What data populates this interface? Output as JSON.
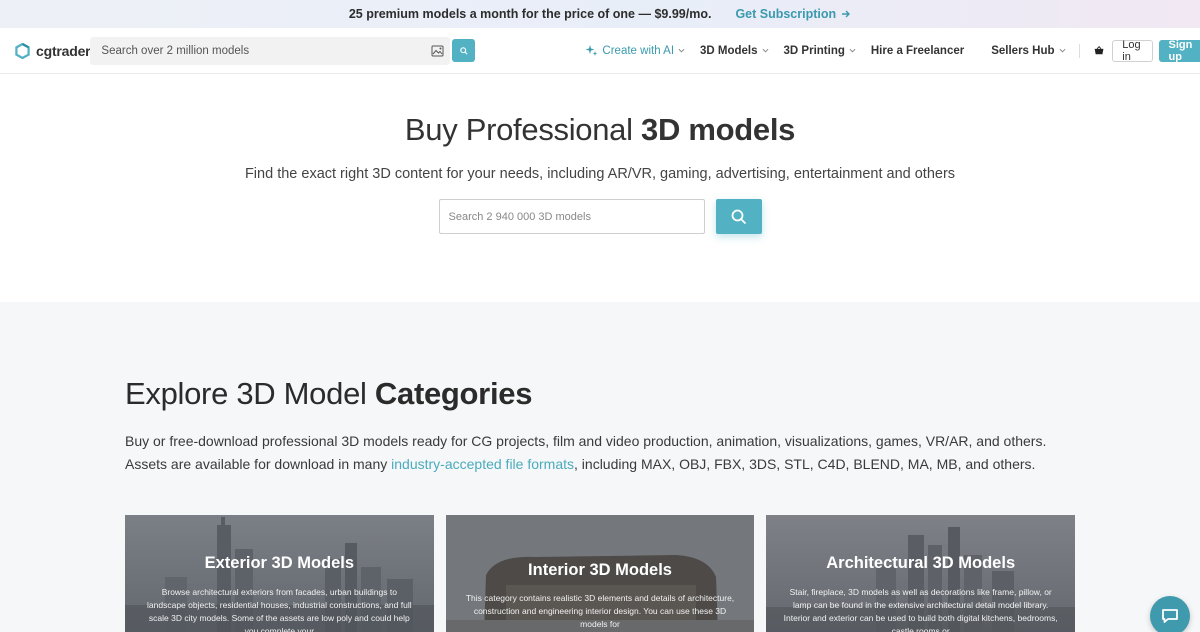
{
  "promo": {
    "text": "25 premium models a month for the price of one — $9.99/mo.",
    "cta": "Get Subscription"
  },
  "header": {
    "logo_text": "cgtrader",
    "search_placeholder": "Search over 2 million models",
    "nav": {
      "ai": "Create with AI",
      "models": "3D Models",
      "printing": "3D Printing",
      "freelancer": "Hire a Freelancer",
      "sellers": "Sellers Hub"
    },
    "login": "Log in",
    "signup": "Sign up"
  },
  "hero": {
    "title_regular": "Buy Professional ",
    "title_bold": "3D models",
    "subtitle": "Find the exact right 3D content for your needs, including AR/VR, gaming, advertising, entertainment and others",
    "search_placeholder": "Search 2 940 000 3D models"
  },
  "explore": {
    "title_regular": "Explore 3D Model ",
    "title_bold": "Categories",
    "desc_before": "Buy or free-download professional 3D models ready for CG projects, film and video production, animation, visualizations, games, VR/AR, and others. Assets are available for download in many ",
    "desc_link": "industry-accepted file formats",
    "desc_after": ", including MAX, OBJ, FBX, 3DS, STL, C4D, BLEND, MA, MB, and others."
  },
  "cards": [
    {
      "title": "Exterior 3D Models",
      "text": "Browse architectural exteriors from facades, urban buildings to landscape objects, residential houses, industrial constructions, and full scale 3D city models. Some of the assets are low poly and could help you complete your"
    },
    {
      "title": "Interior 3D Models",
      "text": "This category contains realistic 3D elements and details of architecture, construction and engineering interior design. You can use these 3D models for"
    },
    {
      "title": "Architectural 3D Models",
      "text": "Stair, fireplace, 3D models as well as decorations like frame, pillow, or lamp can be found in the extensive architectural detail model library. Interior and exterior can be used to build both digital kitchens, bedrooms, castle rooms or"
    }
  ],
  "colors": {
    "accent": "#52b1c3",
    "link": "#4aabbd",
    "chat": "#3e9aac"
  }
}
